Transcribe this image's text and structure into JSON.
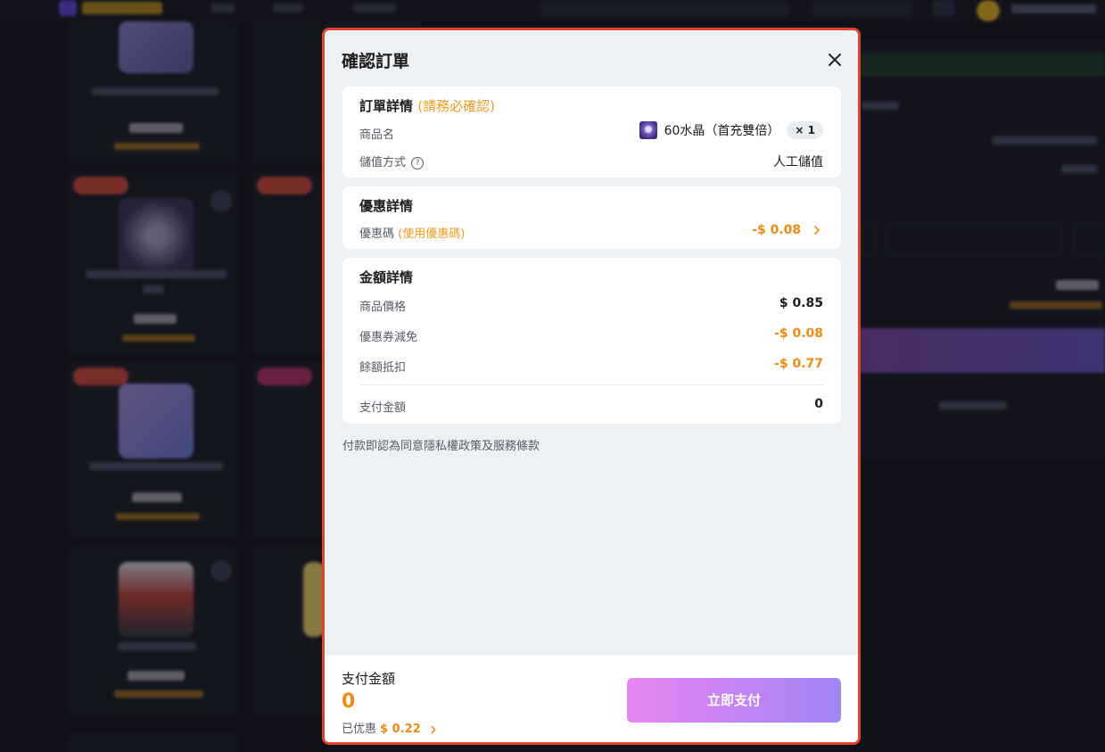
{
  "modal": {
    "title": "確認訂單",
    "close_icon": "close-icon"
  },
  "order_details": {
    "title": "訂單詳情",
    "hint": "(請務必確認)",
    "product_label": "商品名",
    "product_name": "60水晶（首充雙倍）",
    "quantity": "× 1",
    "payment_method_label": "儲值方式",
    "help_icon": "?",
    "payment_method_value": "人工儲值"
  },
  "discount_details": {
    "title": "優惠詳情",
    "coupon_label": "優惠碼",
    "coupon_hint": "(使用優惠碼)",
    "coupon_value": "-$ 0.08"
  },
  "amount_details": {
    "title": "金額詳情",
    "rows": [
      {
        "label": "商品價格",
        "value": "$ 0.85"
      },
      {
        "label": "優惠券減免",
        "value": "-$ 0.08"
      },
      {
        "label": "餘額抵扣",
        "value": "-$ 0.77"
      }
    ],
    "total_label": "支付金額",
    "total_value": "0"
  },
  "agreement_text": "付款即認為同意隱私權政策及服務條款",
  "footer": {
    "pay_label": "支付金額",
    "pay_amount": "0",
    "saved_label": "已优惠",
    "saved_amount": "$ 0.22",
    "pay_button": "立即支付"
  },
  "colors": {
    "accent_orange": "#ef8a12",
    "modal_border": "#e0432c",
    "button_gradient_start": "#e884f2",
    "button_gradient_end": "#a184f5"
  }
}
